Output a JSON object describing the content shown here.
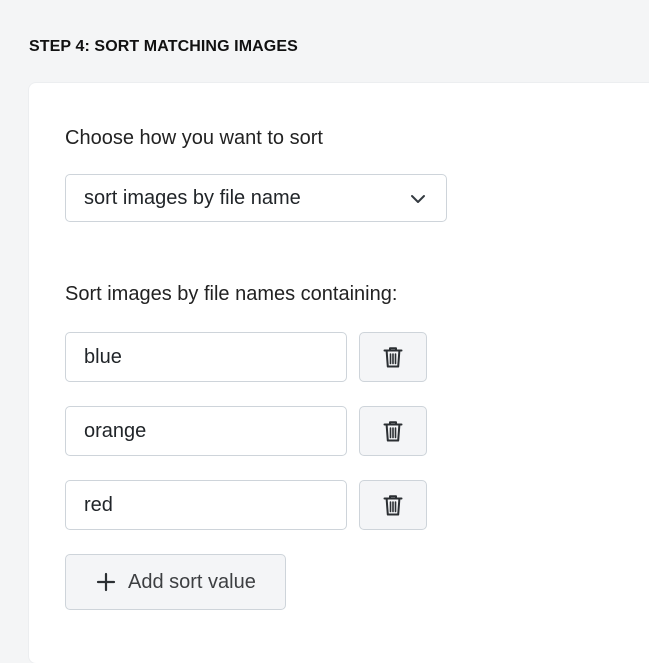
{
  "step": {
    "heading": "STEP 4: SORT MATCHING IMAGES"
  },
  "sort": {
    "label": "Choose how you want to sort",
    "selected": "sort images by file name"
  },
  "values": {
    "label": "Sort images by file names containing:",
    "items": [
      {
        "value": "blue"
      },
      {
        "value": "orange"
      },
      {
        "value": "red"
      }
    ]
  },
  "actions": {
    "add_label": "Add sort value"
  },
  "icons": {
    "dropdown": "chevron-down-icon",
    "delete": "trash-icon",
    "add": "plus-icon"
  }
}
